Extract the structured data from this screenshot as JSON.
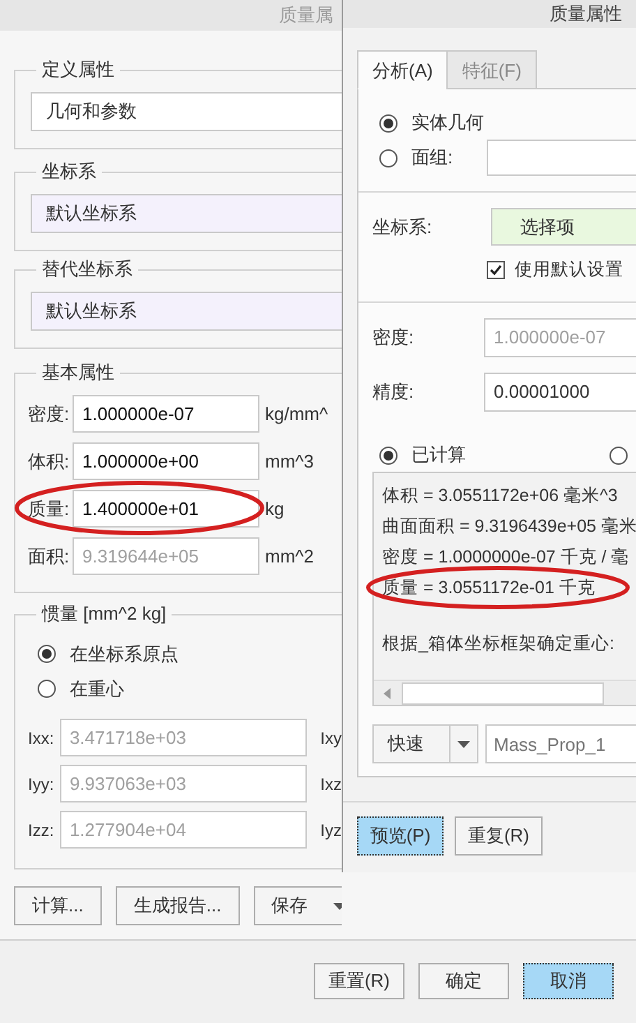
{
  "left_window": {
    "title": "质量属",
    "define": {
      "legend": "定义属性",
      "value": "几何和参数"
    },
    "csys": {
      "legend": "坐标系",
      "value": "默认坐标系"
    },
    "alt_csys": {
      "legend": "替代坐标系",
      "value": "默认坐标系"
    },
    "basic": {
      "legend": "基本属性",
      "rows": [
        {
          "label": "密度:",
          "value": "1.000000e-07",
          "unit": "kg/mm^",
          "disabled": false,
          "circled": false
        },
        {
          "label": "体积:",
          "value": "1.000000e+00",
          "unit": "mm^3",
          "disabled": false,
          "circled": false
        },
        {
          "label": "质量:",
          "value": "1.400000e+01",
          "unit": "kg",
          "disabled": false,
          "circled": true
        },
        {
          "label": "面积:",
          "value": "9.319644e+05",
          "unit": "mm^2",
          "disabled": true,
          "circled": false
        }
      ]
    },
    "inertia": {
      "legend": "惯量 [mm^2 kg]",
      "options": [
        {
          "label": "在坐标系原点",
          "selected": true
        },
        {
          "label": "在重心",
          "selected": false
        }
      ],
      "rows": [
        {
          "label": "Ixx:",
          "value": "3.471718e+03",
          "side_label": "Ixy",
          "disabled": true
        },
        {
          "label": "Iyy:",
          "value": "9.937063e+03",
          "side_label": "Ixz",
          "disabled": true
        },
        {
          "label": "Izz:",
          "value": "1.277904e+04",
          "side_label": "Iyz",
          "disabled": true
        }
      ]
    },
    "actions": [
      {
        "label": "计算...",
        "kind": "button"
      },
      {
        "label": "生成报告...",
        "kind": "button"
      },
      {
        "label": "保存",
        "kind": "split"
      }
    ],
    "footer_buttons": [
      {
        "label": "重置(R)",
        "focused": false
      },
      {
        "label": "确定",
        "focused": false
      },
      {
        "label": "取消",
        "focused": true
      }
    ]
  },
  "right_window": {
    "title": "质量属性",
    "tabs": [
      {
        "label": "分析(A)",
        "selected": true
      },
      {
        "label": "特征(F)",
        "selected": false
      }
    ],
    "geometry_options": [
      {
        "label": "实体几何",
        "selected": true,
        "kind": "plain"
      },
      {
        "label": "面组:",
        "selected": false,
        "kind": "field"
      }
    ],
    "csys": {
      "label": "坐标系:",
      "value": "选择项"
    },
    "use_default": {
      "label": "使用默认设置",
      "checked": true
    },
    "density": {
      "label": "密度:",
      "value": "1.000000e-07",
      "disabled": true
    },
    "precision": {
      "label": "精度:",
      "value": "0.00001000",
      "disabled": false
    },
    "result_options": [
      {
        "label": "已计算",
        "selected": true
      },
      {
        "selected": false
      }
    ],
    "results": [
      {
        "text": "体积 =  3.0551172e+06  毫米^3",
        "kind": "line",
        "circled": false
      },
      {
        "text": "曲面面积 =  9.3196439e+05  毫米",
        "kind": "line",
        "circled": false
      },
      {
        "text": "密度 =  1.0000000e-07  千克 / 毫",
        "kind": "line",
        "circled": false
      },
      {
        "text": "质量 =  3.0551172e-01  千克",
        "kind": "line",
        "circled": true
      },
      {
        "text": "根据_箱体坐标框架确定重心:",
        "kind": "note",
        "circled": false
      }
    ],
    "mode": {
      "value": "快速"
    },
    "name_field": {
      "placeholder": "Mass_Prop_1"
    },
    "buttons": [
      {
        "label": "预览(P)",
        "focused": true
      },
      {
        "label": "重复(R)",
        "focused": false
      }
    ]
  }
}
